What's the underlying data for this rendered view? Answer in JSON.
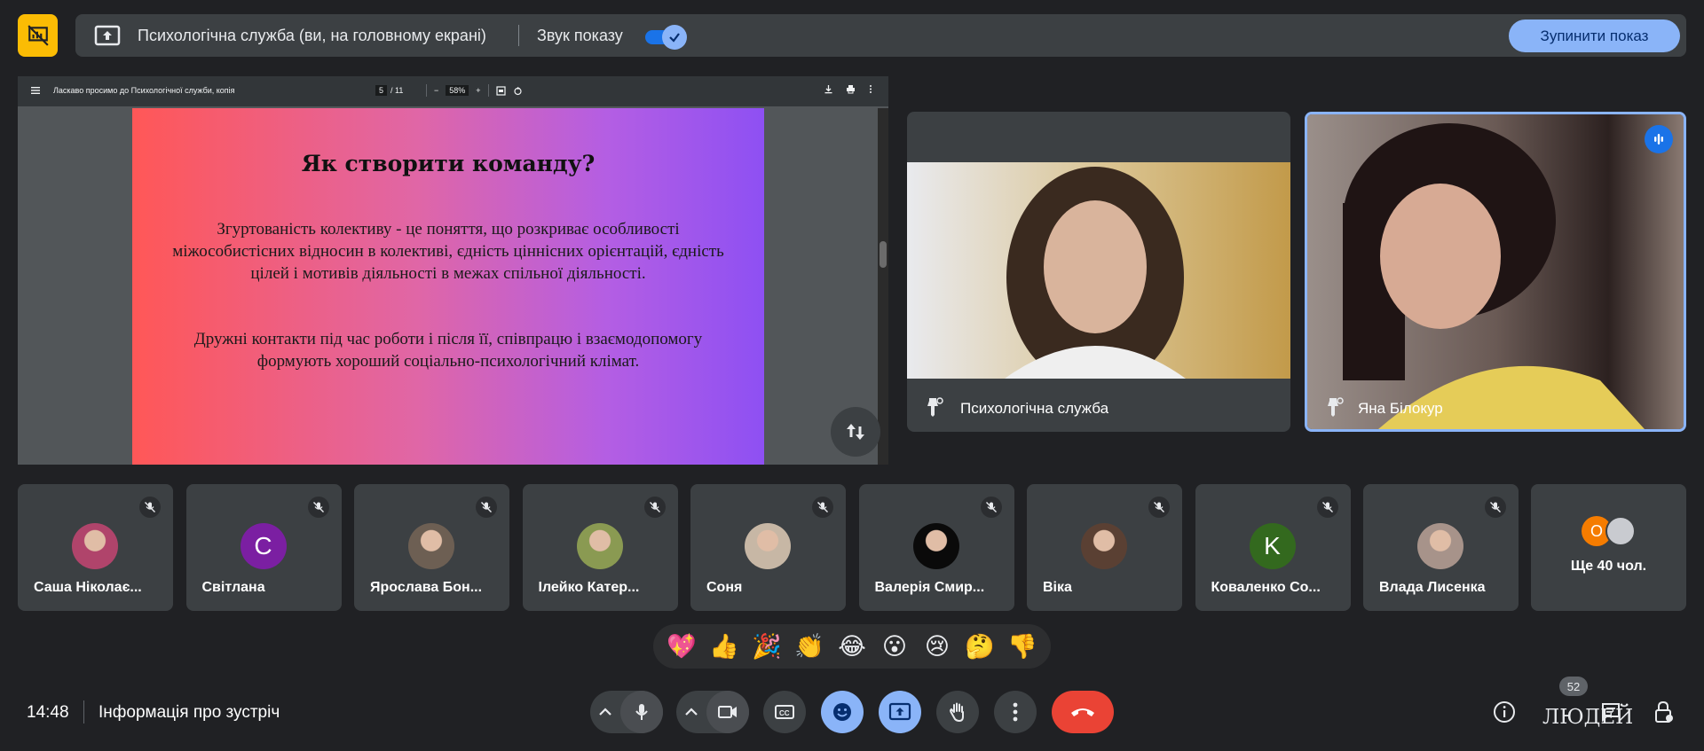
{
  "banner": {
    "title": "Психологічна служба (ви, на головному екрані)",
    "sound_label": "Звук показу",
    "sound_on": true,
    "stop_label": "Зупинити показ"
  },
  "pdf": {
    "filename": "Ласкаво просимо до Психологічної служби, копія",
    "page_current": "5",
    "page_total": "/ 11",
    "zoom": "58%"
  },
  "slide": {
    "title": "Як створити команду?",
    "paragraph1": "Згуртованість колективу - це поняття, що розкриває особливості міжособистісних відносин в колективі, єдність ціннісних орієнтацій, єдність цілей і мотивів діяльності в межах спільної діяльності.",
    "paragraph2": "Дружні контакти під час роботи і після її, співпрацю і взаємодопомогу формують хороший соціально-психологічний клімат."
  },
  "videos": [
    {
      "name": "Психологічна служба"
    },
    {
      "name": "Яна Білокур",
      "speaking": true
    }
  ],
  "participants": [
    {
      "name": "Саша Ніколає...",
      "avatar_type": "photo",
      "color": "#b0446b"
    },
    {
      "name": "Світлана",
      "avatar_type": "letter",
      "letter": "С",
      "color": "#7b1fa2"
    },
    {
      "name": "Ярослава Бон...",
      "avatar_type": "photo",
      "color": "#6d5f53"
    },
    {
      "name": "Ілейко Катер...",
      "avatar_type": "photo",
      "color": "#8a9a52"
    },
    {
      "name": "Соня",
      "avatar_type": "photo",
      "color": "#c7b7a5"
    },
    {
      "name": "Валерія Смир...",
      "avatar_type": "photo",
      "color": "#0a0a0a"
    },
    {
      "name": "Віка",
      "avatar_type": "photo",
      "color": "#5a4033"
    },
    {
      "name": "Коваленко Со...",
      "avatar_type": "letter",
      "letter": "K",
      "color": "#33691e"
    },
    {
      "name": "Влада Лисенка",
      "avatar_type": "photo",
      "color": "#a7938a"
    }
  ],
  "more": {
    "label": "Ще 40 чол.",
    "letter": "О"
  },
  "reactions": [
    "💖",
    "👍",
    "🎉",
    "👏",
    "😂",
    "😮",
    "😢",
    "🤔",
    "👎"
  ],
  "bottom": {
    "time": "14:48",
    "meeting_info": "Інформація про зустріч",
    "people_label": "ЛЮДЕЙ",
    "people_count": "52"
  },
  "colors": {
    "background": "#202124",
    "surface": "#3c4043",
    "accent": "#8ab4f8",
    "hangup": "#ea4335",
    "present_badge": "#fbbc04"
  }
}
